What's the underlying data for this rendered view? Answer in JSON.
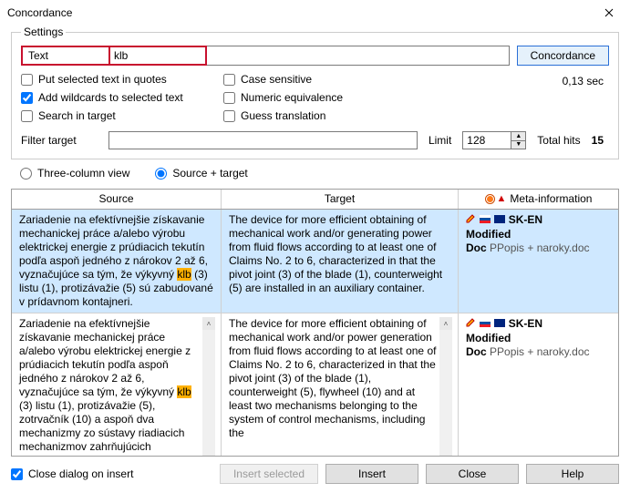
{
  "title": "Concordance",
  "settings_legend": "Settings",
  "label_text": "Text",
  "search_value": "klb",
  "btn_concordance": "Concordance",
  "opts": {
    "put_quotes": "Put selected text in quotes",
    "add_wildcards": "Add wildcards to selected text",
    "search_in_target": "Search in target",
    "case_sensitive": "Case sensitive",
    "numeric_equiv": "Numeric equivalence",
    "guess_translation": "Guess translation"
  },
  "timing": "0,13 sec",
  "filter_target_lbl": "Filter target",
  "filter_target_val": "",
  "limit_lbl": "Limit",
  "limit_val": "128",
  "total_hits_lbl": "Total hits",
  "total_hits_val": "15",
  "view": {
    "three_col": "Three-column view",
    "src_tgt": "Source + target"
  },
  "headers": {
    "source": "Source",
    "target": "Target",
    "meta": "Meta-information"
  },
  "rows": [
    {
      "source_pre": "Zariadenie na efektívnejšie získavanie mechanickej práce a/alebo výrobu elektrickej energie z prúdiacich tekutín podľa aspoň jedného z nárokov 2 až 6, vyznačujúce sa tým, že výkyvný ",
      "source_hl": "klb",
      "source_post": " (3) listu (1), protizávažie (5) sú zabudované v prídavnom kontajneri.",
      "target": "The device for more efficient obtaining of mechanical work and/or generating power from fluid flows according to at least one of Claims No. 2 to 6, characterized in that the pivot joint (3) of the blade (1), counterweight (5) are installed in an auxiliary container.",
      "meta_pair": "SK-EN",
      "meta_mod": "Modified",
      "meta_doc_lbl": "Doc",
      "meta_doc": "PPopis + naroky.doc"
    },
    {
      "source_pre": "Zariadenie na efektívnejšie získavanie mechanickej práce a/alebo výrobu elektrickej energie z prúdiacich tekutín podľa aspoň jedného z nárokov 2 až 6, vyznačujúce sa tým, že výkyvný ",
      "source_hl": "klb",
      "source_post": " (3) listu (1), protizávažie (5), zotrvačník (10) a aspoň dva mechanizmy zo sústavy riadiacich mechanizmov zahrňujúcich mechanizmus (A) na",
      "target": "The device for more efficient obtaining of mechanical work and/or power generation from fluid flows according to at least one of Claims No. 2 to 6, characterized in that the pivot joint (3) of the blade (1), counterweight (5), flywheel (10) and at least two mechanisms belonging to the system of control mechanisms, including the",
      "meta_pair": "SK-EN",
      "meta_mod": "Modified",
      "meta_doc_lbl": "Doc",
      "meta_doc": "PPopis + naroky.doc"
    }
  ],
  "footer": {
    "close_on_insert": "Close dialog on insert",
    "insert_selected": "Insert selected",
    "insert": "Insert",
    "close": "Close",
    "help": "Help"
  }
}
